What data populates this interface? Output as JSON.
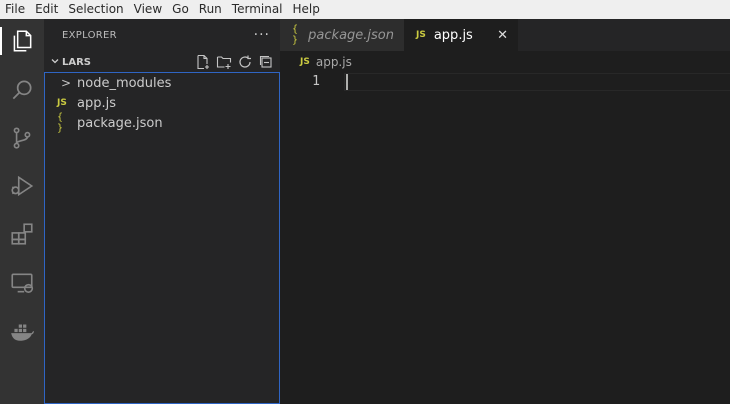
{
  "menubar": {
    "items": [
      "File",
      "Edit",
      "Selection",
      "View",
      "Go",
      "Run",
      "Terminal",
      "Help"
    ]
  },
  "activity": {
    "items": [
      "explorer-icon",
      "search-icon",
      "source-control-icon",
      "run-debug-icon",
      "extensions-icon",
      "remote-explorer-icon",
      "docker-icon"
    ]
  },
  "sidebar": {
    "title": "EXPLORER",
    "more": "···",
    "section": {
      "title": "LARS",
      "actions": [
        "new-file-icon",
        "new-folder-icon",
        "refresh-icon",
        "collapse-all-icon"
      ]
    },
    "tree": [
      {
        "label": "node_modules",
        "type": "folder",
        "icon": ">"
      },
      {
        "label": "app.js",
        "type": "js",
        "icon": "JS"
      },
      {
        "label": "package.json",
        "type": "json",
        "icon": "{ }"
      }
    ]
  },
  "tabs": [
    {
      "label": "package.json",
      "icon": "{ }",
      "active": false
    },
    {
      "label": "app.js",
      "icon": "JS",
      "active": true,
      "close": "✕"
    }
  ],
  "breadcrumb": {
    "icon": "JS",
    "label": "app.js"
  },
  "editor": {
    "line_number": "1"
  },
  "colors": {
    "accent_border": "#2f65c4",
    "js_icon": "#cbcb41"
  }
}
